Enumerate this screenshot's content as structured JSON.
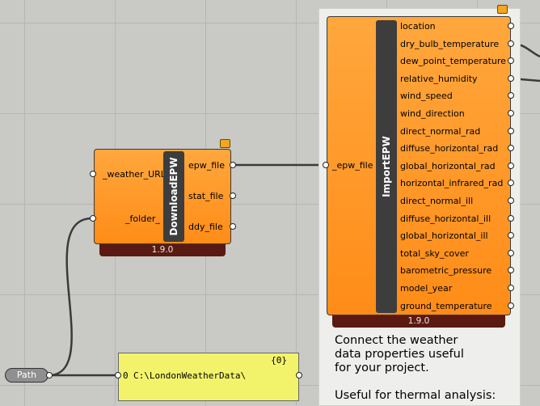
{
  "download_component": {
    "name": "DownloadEPW",
    "inputs": [
      "_weather_URL",
      "_folder_"
    ],
    "outputs": [
      "epw_file",
      "stat_file",
      "ddy_file"
    ],
    "version": "1.9.0"
  },
  "import_component": {
    "name": "ImportEPW",
    "input": "_epw_file",
    "outputs": [
      "location",
      "dry_bulb_temperature",
      "dew_point_temperature",
      "relative_humidity",
      "wind_speed",
      "wind_direction",
      "direct_normal_rad",
      "diffuse_horizontal_rad",
      "global_horizontal_rad",
      "horizontal_infrared_rad",
      "direct_normal_ill",
      "diffuse_horizontal_ill",
      "global_horizontal_ill",
      "total_sky_cover",
      "barometric_pressure",
      "model_year",
      "ground_temperature"
    ],
    "version": "1.9.0"
  },
  "panel": {
    "index_tag": "{0}",
    "row_index": "0",
    "value": "C:\\LondonWeatherData\\"
  },
  "path_node": {
    "label": "Path"
  },
  "notes": {
    "line1": "Connect the weather",
    "line2": "data properties useful",
    "line3": "for your project.",
    "line4": "Useful for thermal analysis:"
  },
  "colors": {
    "component_orange": "#ff9a26",
    "version_bar": "#5a1a12",
    "panel_yellow": "#f3f36b",
    "canvas": "#c9c9c5"
  }
}
